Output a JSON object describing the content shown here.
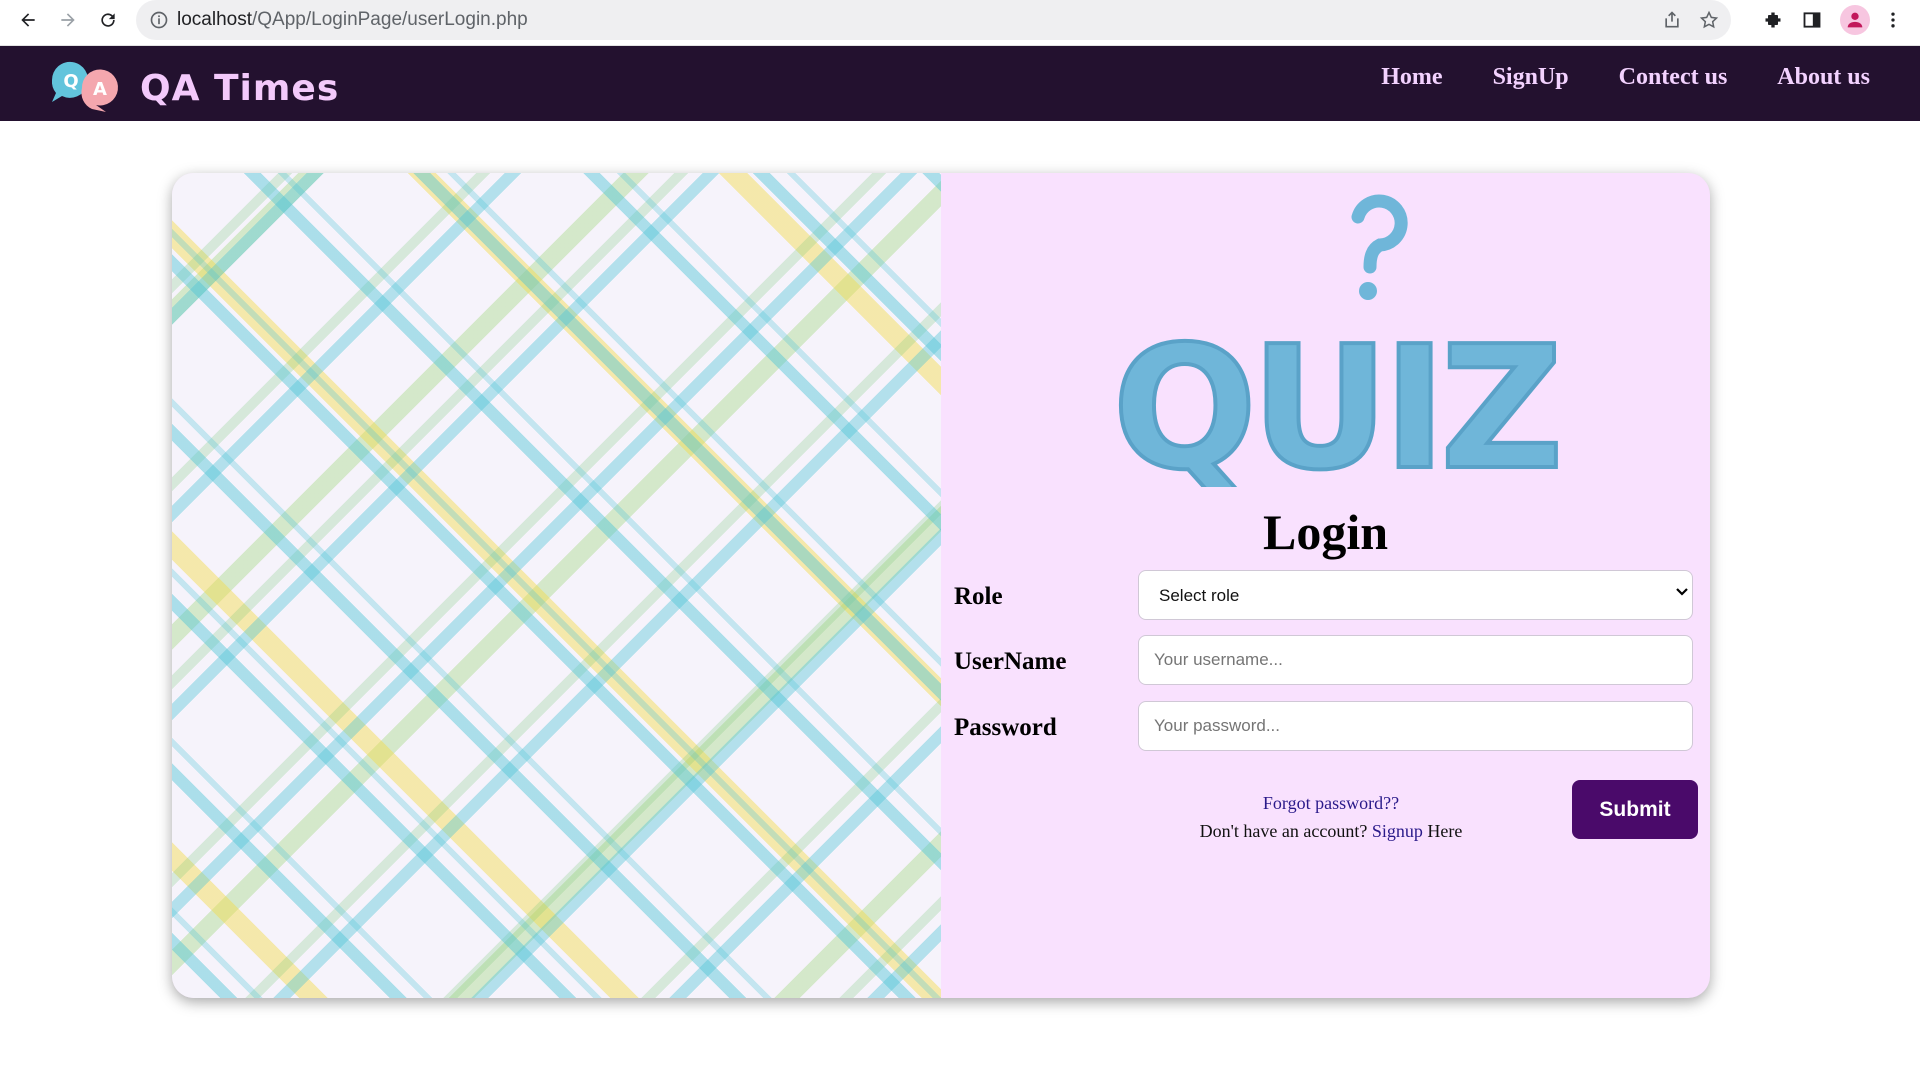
{
  "browser": {
    "url_host": "localhost",
    "url_path": "/QApp/LoginPage/userLogin.php"
  },
  "site": {
    "logo_letters": [
      "Q",
      "A"
    ],
    "brand": "QA Times",
    "nav": [
      "Home",
      "SignUp",
      "Contect us",
      "About us"
    ]
  },
  "login": {
    "graphic_text": "QUIZ",
    "title": "Login",
    "role_label": "Role",
    "role_selected": "Select role",
    "username_label": "UserName",
    "username_placeholder": "Your username...",
    "password_label": "Password",
    "password_placeholder": "Your password...",
    "forgot_text": "Forgot password??",
    "no_account_text": "Don't have an account?",
    "signup_link": "Signup",
    "signup_suffix": "Here",
    "submit_label": "Submit"
  },
  "colors": {
    "navbar_bg": "#23112f",
    "brand_text": "#f3c9fb",
    "card_bg": "#f9e1fe",
    "submit_bg": "#4a0a6a",
    "quiz_blue": "#6fb6d9"
  }
}
